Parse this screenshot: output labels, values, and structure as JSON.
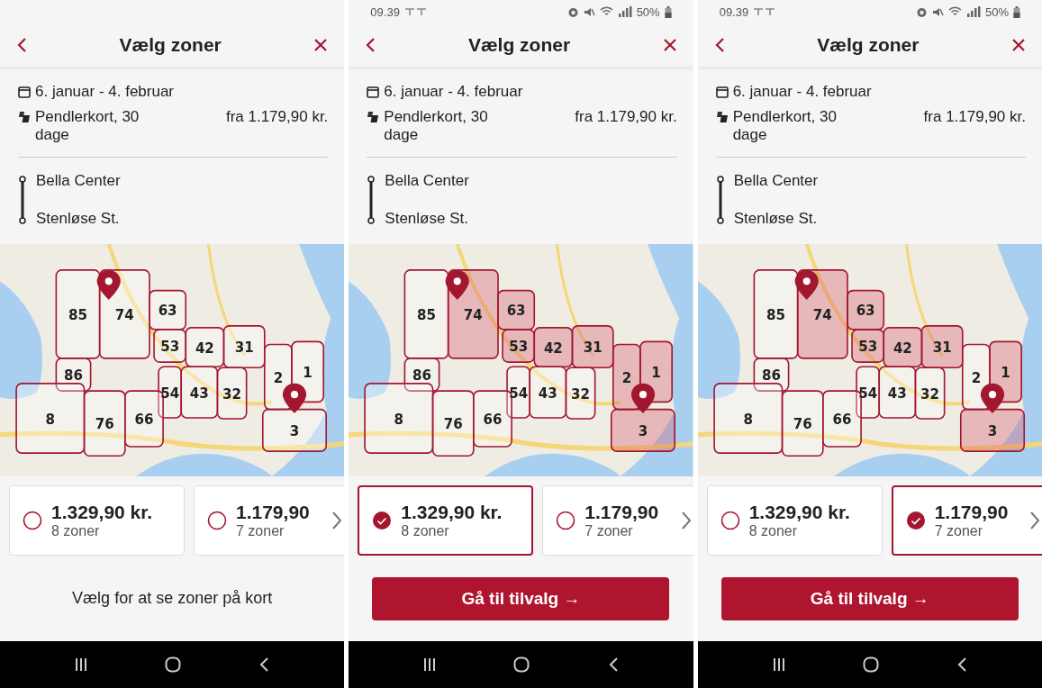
{
  "panels": [
    {
      "header": {
        "title": "Vælg zoner"
      },
      "period": "6. januar - 4. februar",
      "ticket": {
        "name": "Pendlerkort, 30 dage",
        "price": "fra 1.179,90 kr."
      },
      "route": {
        "from": "Bella Center",
        "to": "Stenløse St."
      },
      "map": {
        "zones": [
          {
            "label": "85",
            "highlighted": false
          },
          {
            "label": "74",
            "highlighted": false
          },
          {
            "label": "63",
            "highlighted": false
          },
          {
            "label": "53",
            "highlighted": false
          },
          {
            "label": "42",
            "highlighted": false
          },
          {
            "label": "31",
            "highlighted": false
          },
          {
            "label": "86",
            "highlighted": false
          },
          {
            "label": "2",
            "highlighted": false
          },
          {
            "label": "1",
            "highlighted": false
          },
          {
            "label": "54",
            "highlighted": false
          },
          {
            "label": "43",
            "highlighted": false
          },
          {
            "label": "32",
            "highlighted": false
          },
          {
            "label": "8",
            "highlighted": false
          },
          {
            "label": "76",
            "highlighted": false
          },
          {
            "label": "66",
            "highlighted": false
          },
          {
            "label": "3",
            "highlighted": false
          }
        ]
      },
      "options": [
        {
          "price": "1.329,90 kr.",
          "zones": "8 zoner",
          "selected": false
        },
        {
          "price": "1.179,90",
          "zones": "7 zoner",
          "selected": false
        }
      ],
      "footer": {
        "kind": "hint",
        "text": "Vælg for at se zoner på kort"
      }
    },
    {
      "status_bar": {
        "time": "09.39",
        "battery": "50%"
      },
      "header": {
        "title": "Vælg zoner"
      },
      "period": "6. januar - 4. februar",
      "ticket": {
        "name": "Pendlerkort, 30 dage",
        "price": "fra 1.179,90 kr."
      },
      "route": {
        "from": "Bella Center",
        "to": "Stenløse St."
      },
      "map": {
        "zones": [
          {
            "label": "85",
            "highlighted": false
          },
          {
            "label": "74",
            "highlighted": true
          },
          {
            "label": "63",
            "highlighted": true
          },
          {
            "label": "53",
            "highlighted": true
          },
          {
            "label": "42",
            "highlighted": true
          },
          {
            "label": "31",
            "highlighted": true
          },
          {
            "label": "86",
            "highlighted": false
          },
          {
            "label": "2",
            "highlighted": true
          },
          {
            "label": "1",
            "highlighted": true
          },
          {
            "label": "54",
            "highlighted": false
          },
          {
            "label": "43",
            "highlighted": false
          },
          {
            "label": "32",
            "highlighted": false
          },
          {
            "label": "8",
            "highlighted": false
          },
          {
            "label": "76",
            "highlighted": false
          },
          {
            "label": "66",
            "highlighted": false
          },
          {
            "label": "3",
            "highlighted": true
          }
        ]
      },
      "options": [
        {
          "price": "1.329,90 kr.",
          "zones": "8 zoner",
          "selected": true
        },
        {
          "price": "1.179,90",
          "zones": "7 zoner",
          "selected": false
        }
      ],
      "footer": {
        "kind": "button",
        "text": "Gå til tilvalg →"
      }
    },
    {
      "status_bar": {
        "time": "09.39",
        "battery": "50%"
      },
      "header": {
        "title": "Vælg zoner"
      },
      "period": "6. januar - 4. februar",
      "ticket": {
        "name": "Pendlerkort, 30 dage",
        "price": "fra 1.179,90 kr."
      },
      "route": {
        "from": "Bella Center",
        "to": "Stenløse St."
      },
      "map": {
        "zones": [
          {
            "label": "85",
            "highlighted": false
          },
          {
            "label": "74",
            "highlighted": true
          },
          {
            "label": "63",
            "highlighted": true
          },
          {
            "label": "53",
            "highlighted": true
          },
          {
            "label": "42",
            "highlighted": true
          },
          {
            "label": "31",
            "highlighted": true
          },
          {
            "label": "86",
            "highlighted": false
          },
          {
            "label": "2",
            "highlighted": false
          },
          {
            "label": "1",
            "highlighted": true
          },
          {
            "label": "54",
            "highlighted": false
          },
          {
            "label": "43",
            "highlighted": false
          },
          {
            "label": "32",
            "highlighted": false
          },
          {
            "label": "8",
            "highlighted": false
          },
          {
            "label": "76",
            "highlighted": false
          },
          {
            "label": "66",
            "highlighted": false
          },
          {
            "label": "3",
            "highlighted": true
          }
        ]
      },
      "options": [
        {
          "price": "1.329,90 kr.",
          "zones": "8 zoner",
          "selected": false
        },
        {
          "price": "1.179,90",
          "zones": "7 zoner",
          "selected": true
        }
      ],
      "footer": {
        "kind": "button",
        "text": "Gå til tilvalg →"
      }
    }
  ]
}
